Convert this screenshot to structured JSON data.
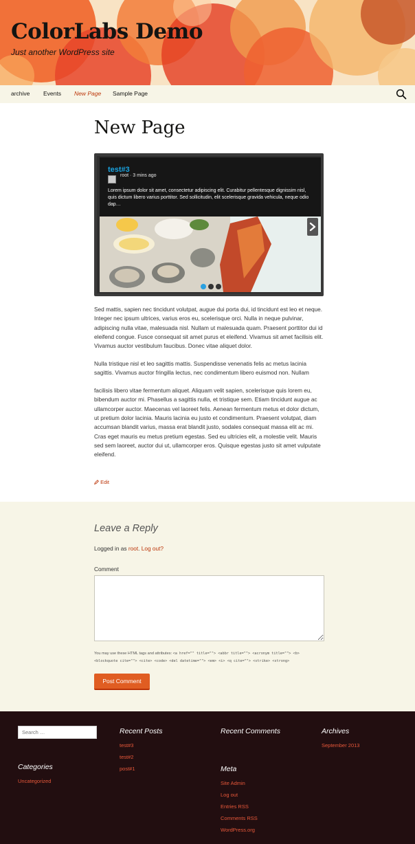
{
  "site": {
    "title": "ColorLabs Demo",
    "description": "Just another WordPress site"
  },
  "nav": {
    "items": [
      {
        "label": "archive",
        "current": false
      },
      {
        "label": "Events",
        "current": false
      },
      {
        "label": "New Page",
        "current": true
      },
      {
        "label": "Sample Page",
        "current": false
      }
    ],
    "search_icon": "search-icon"
  },
  "page": {
    "title": "New Page",
    "slider": {
      "slide_title": "test#3",
      "meta": "root · 3 mins ago",
      "excerpt": "Lorem ipsum dolor sit amet, consectetur adipiscing elit. Curabitur pellentesque dignissim nisl, quis dictum libero varius porttitor. Sed sollicitudin, elit scelerisque gravida vehicula, neque odio dap…",
      "next_icon": "chevron-right-icon",
      "dots": 3,
      "active_dot": 1
    },
    "paragraphs": [
      "Sed mattis, sapien nec tincidunt volutpat, augue dui porta dui, id tincidunt est leo et neque. Integer nec ipsum ultrices, varius eros eu, scelerisque orci. Nulla in neque pulvinar, adipiscing nulla vitae, malesuada nisl. Nullam ut malesuada quam. Praesent porttitor dui id eleifend congue. Fusce consequat sit amet purus et eleifend. Vivamus sit amet facilisis elit. Vivamus auctor vestibulum faucibus. Donec vitae aliquet dolor.",
      "Nulla tristique nisl et leo sagittis mattis. Suspendisse venenatis felis ac metus lacinia sagittis. Vivamus auctor fringilla lectus, nec condimentum libero euismod non. Nullam",
      "facilisis libero vitae fermentum aliquet. Aliquam velit sapien, scelerisque quis lorem eu, bibendum auctor mi. Phasellus a sagittis nulla, et tristique sem. Etiam tincidunt augue ac ullamcorper auctor. Maecenas vel laoreet felis. Aenean fermentum metus et dolor dictum, ut pretium dolor lacinia. Mauris lacinia eu justo et condimentum. Praesent volutpat, diam accumsan blandit varius, massa erat blandit justo, sodales consequat massa elit ac mi. Cras eget mauris eu metus pretium egestas. Sed eu ultricies elit, a molestie velit. Mauris sed sem laoreet, auctor dui ut, ullamcorper eros. Quisque egestas justo sit amet vulputate eleifend."
    ],
    "edit_label": "Edit",
    "edit_icon": "pencil-icon"
  },
  "comments": {
    "reply_title": "Leave a Reply",
    "logged_in_prefix": "Logged in as ",
    "user": "root",
    "separator": ". ",
    "logout": "Log out?",
    "comment_label": "Comment",
    "allowed_prefix": "You may use these HTML tags and attributes: ",
    "allowed_tags": "<a href=\"\" title=\"\"> <abbr title=\"\"> <acronym title=\"\"> <b> <blockquote cite=\"\"> <cite> <code> <del datetime=\"\"> <em> <i> <q cite=\"\"> <strike> <strong>",
    "submit_label": "Post Comment",
    "accent_color": "#e05d22"
  },
  "footer": {
    "search_placeholder": "Search …",
    "recent_posts_title": "Recent Posts",
    "recent_posts": [
      "test#3",
      "test#2",
      "post#1"
    ],
    "recent_comments_title": "Recent Comments",
    "archives_title": "Archives",
    "archives": [
      "September 2013"
    ],
    "categories_title": "Categories",
    "categories": [
      "Uncategorized"
    ],
    "meta_title": "Meta",
    "meta_links": [
      "Site Admin",
      "Log out",
      "Entries RSS",
      "Comments RSS",
      "WordPress.org"
    ],
    "background_color": "#220e10",
    "link_color": "#e8583a"
  }
}
